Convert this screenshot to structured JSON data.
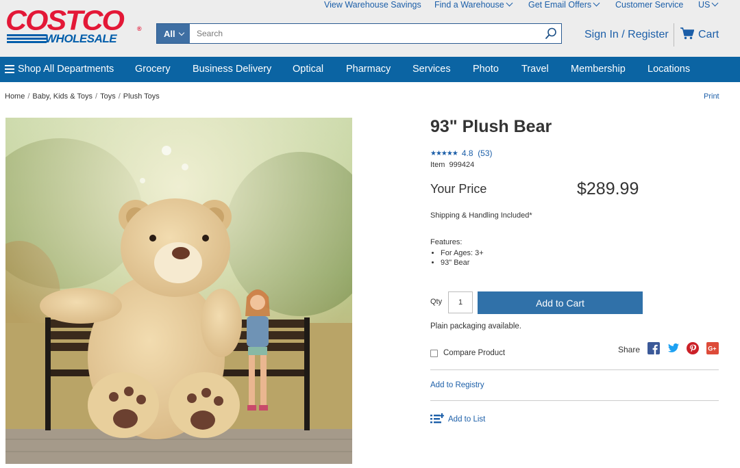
{
  "brand": {
    "logo_top": "COSTCO",
    "logo_bottom": "WHOLESALE",
    "logo_reg": "®"
  },
  "top_links": [
    {
      "label": "View Warehouse Savings",
      "dropdown": false
    },
    {
      "label": "Find a Warehouse",
      "dropdown": true
    },
    {
      "label": "Get Email Offers",
      "dropdown": true
    },
    {
      "label": "Customer Service",
      "dropdown": false
    },
    {
      "label": "US",
      "dropdown": true
    }
  ],
  "search": {
    "category": "All",
    "placeholder": "Search",
    "value": ""
  },
  "account": {
    "signin_label": "Sign In / Register",
    "cart_label": "Cart"
  },
  "nav": {
    "shop_all": "Shop All Departments",
    "items": [
      "Grocery",
      "Business Delivery",
      "Optical",
      "Pharmacy",
      "Services",
      "Photo",
      "Travel",
      "Membership",
      "Locations"
    ]
  },
  "breadcrumb": [
    "Home",
    "Baby, Kids & Toys",
    "Toys",
    "Plush Toys"
  ],
  "print_label": "Print",
  "product": {
    "title": "93\" Plush Bear",
    "rating_value": "4.8",
    "rating_stars": "★★★★★",
    "review_count": "(53)",
    "item_label": "Item",
    "item_number": "999424",
    "your_price_label": "Your Price",
    "price": "$289.99",
    "shipping": "Shipping & Handling Included*",
    "features_label": "Features:",
    "features": [
      "For Ages: 3+",
      "93\" Bear"
    ],
    "qty_label": "Qty",
    "qty_value": "1",
    "add_to_cart": "Add to Cart",
    "plain_packaging": "Plain packaging available.",
    "compare_label": "Compare Product",
    "compare_checked": false,
    "share_label": "Share",
    "social": [
      "facebook-icon",
      "twitter-icon",
      "pinterest-icon",
      "google-plus-icon"
    ],
    "add_registry": "Add to Registry",
    "add_list": "Add to List"
  },
  "colors": {
    "brand_red": "#e31837",
    "brand_blue": "#005daa",
    "nav_blue": "#0b64a3",
    "link_blue": "#1b5ea8",
    "button_blue": "#3071a9"
  }
}
